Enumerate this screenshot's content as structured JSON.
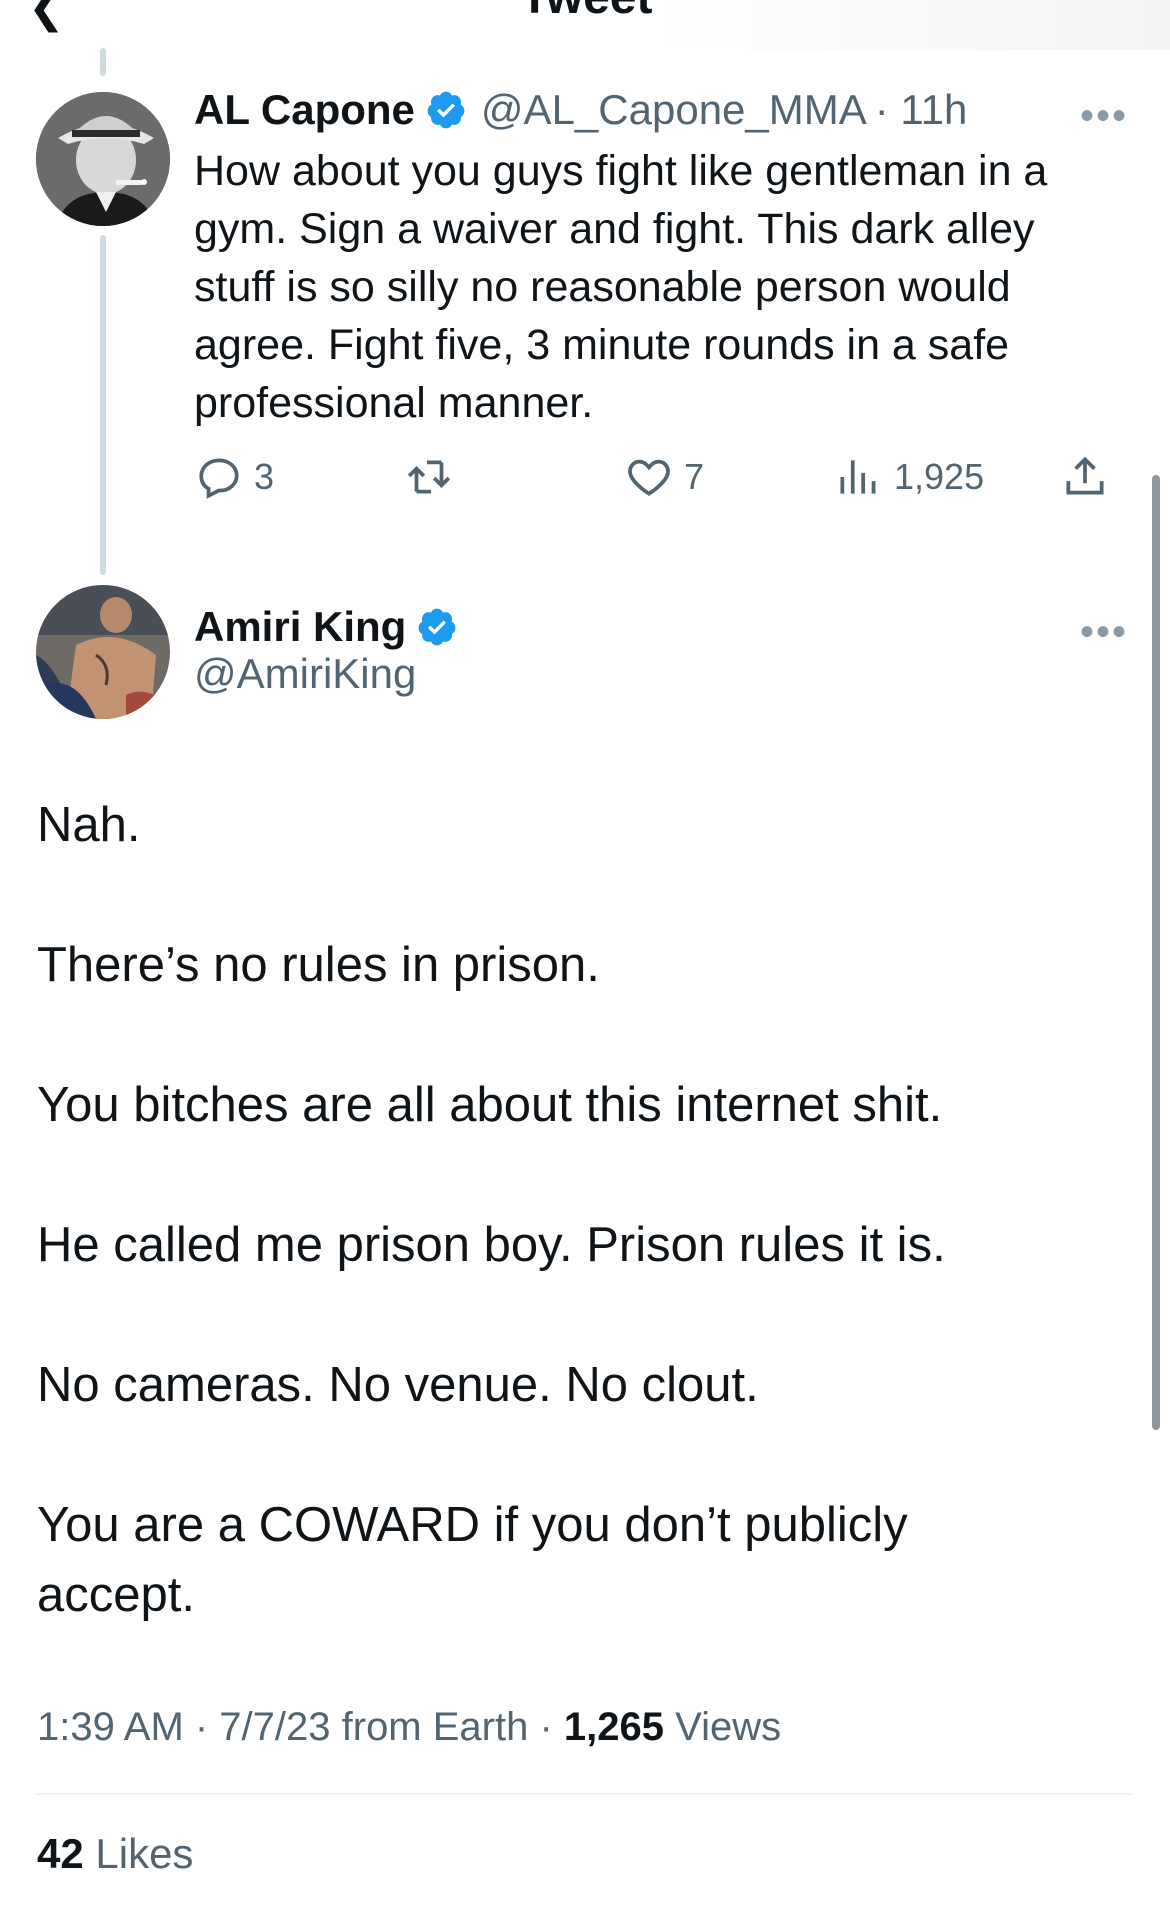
{
  "header": {
    "title": "Tweet",
    "back_icon": "back-arrow-icon"
  },
  "parent_tweet": {
    "name": "AL Capone",
    "handle": "@AL_Capone_MMA",
    "time": "· 11h",
    "text": "How about you guys fight like gentleman in a gym. Sign a waiver and fight. This dark alley stuff is so silly no reasonable person would agree. Fight five, 3 minute rounds in a safe professional manner.",
    "actions": {
      "replies": "3",
      "likes": "7",
      "views": "1,925"
    }
  },
  "main_tweet": {
    "name": "Amiri King",
    "handle": "@AmiriKing",
    "paragraphs": [
      "Nah.",
      "There’s no rules in prison.",
      "You bitches are all about this internet shit.",
      "He called me prison boy. Prison rules it is.",
      "No cameras. No venue. No clout.",
      "You are a COWARD if you don’t publicly accept."
    ],
    "meta": {
      "timestamp": "1:39 AM · 7/7/23 from Earth · ",
      "views_count": "1,265",
      "views_label": " Views"
    },
    "likes": {
      "count": "42",
      "label": " Likes"
    }
  },
  "colors": {
    "verified": "#1d9bf0",
    "secondary_text": "#536471",
    "primary_text": "#0f1419",
    "thread_line": "#cfd9de"
  }
}
